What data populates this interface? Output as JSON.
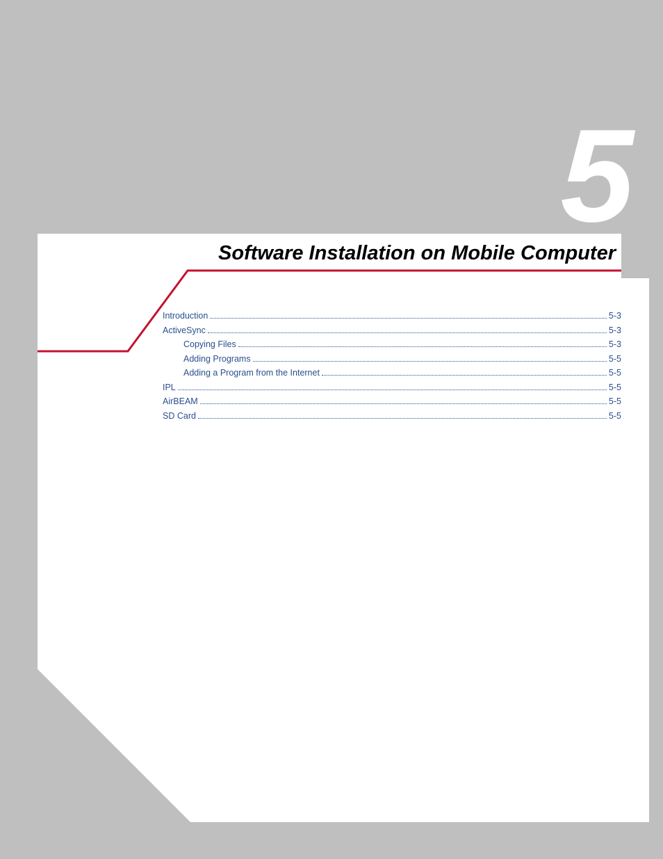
{
  "chapter": {
    "number": "5",
    "title": "Software Installation on Mobile Computer"
  },
  "toc": [
    {
      "label": "Introduction",
      "page": "5-3",
      "indent": 0
    },
    {
      "label": "ActiveSync",
      "page": "5-3",
      "indent": 0
    },
    {
      "label": "Copying Files",
      "page": "5-3",
      "indent": 1
    },
    {
      "label": "Adding Programs",
      "page": "5-5",
      "indent": 1
    },
    {
      "label": "Adding a Program from the Internet",
      "page": "5-5",
      "indent": 1
    },
    {
      "label": "IPL",
      "page": "5-5",
      "indent": 0
    },
    {
      "label": "AirBEAM",
      "page": "5-5",
      "indent": 0
    },
    {
      "label": "SD Card",
      "page": "5-5",
      "indent": 0
    }
  ]
}
